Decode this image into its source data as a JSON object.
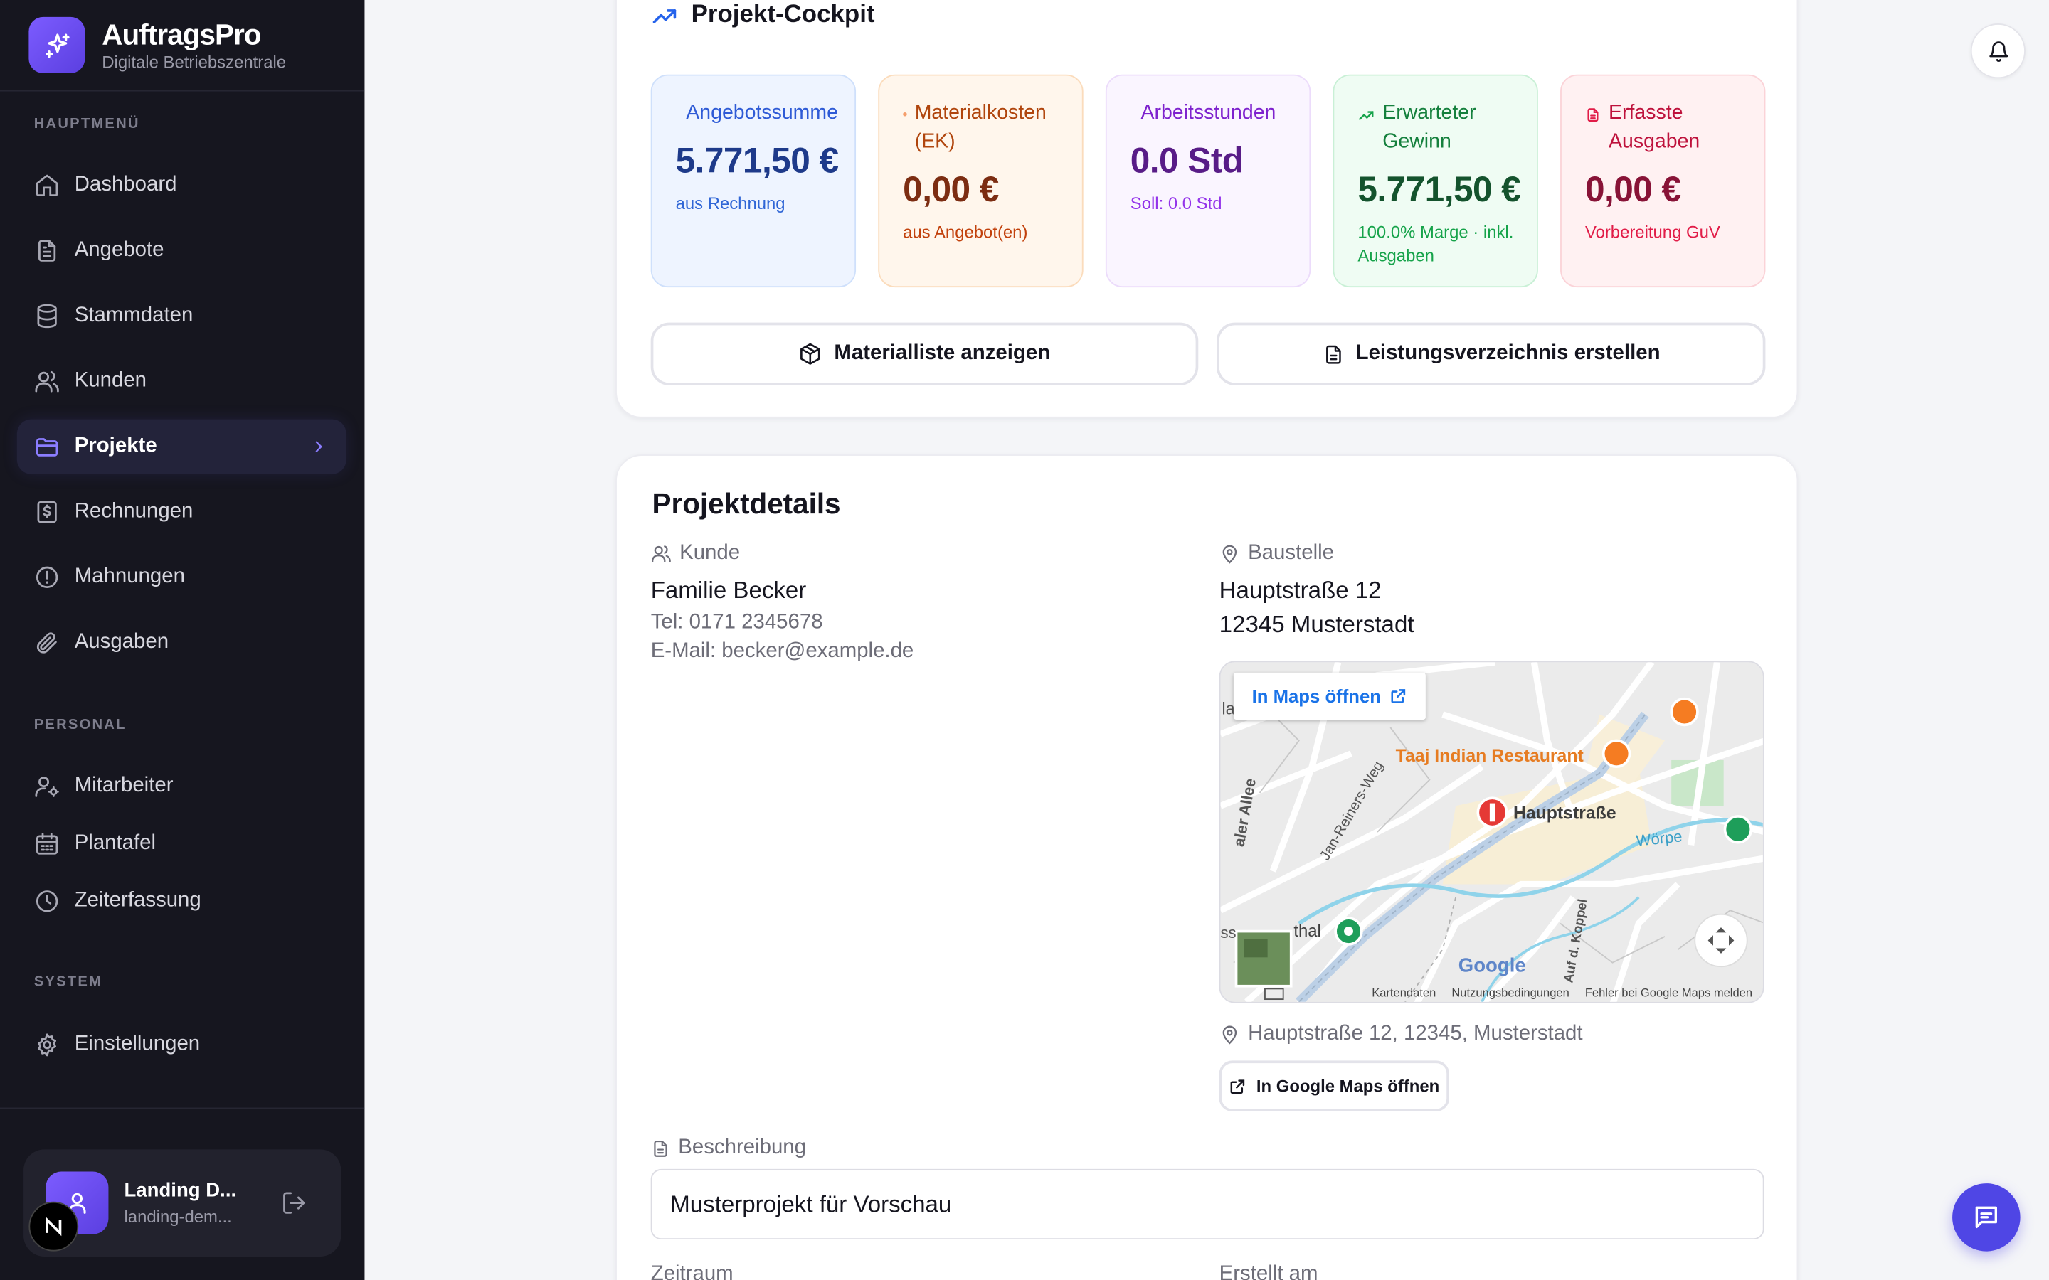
{
  "brand": {
    "name": "AuftragsPro",
    "subtitle": "Digitale Betriebszentrale"
  },
  "sidebar": {
    "sections": {
      "main": "HAUPTMENÜ",
      "personal": "PERSONAL",
      "system": "SYSTEM"
    },
    "items": [
      {
        "label": "Dashboard",
        "icon": "home-icon"
      },
      {
        "label": "Angebote",
        "icon": "document-icon"
      },
      {
        "label": "Stammdaten",
        "icon": "database-icon"
      },
      {
        "label": "Kunden",
        "icon": "users-icon"
      },
      {
        "label": "Projekte",
        "icon": "folder-icon",
        "active": true
      },
      {
        "label": "Rechnungen",
        "icon": "receipt-icon"
      },
      {
        "label": "Mahnungen",
        "icon": "alert-circle-icon"
      },
      {
        "label": "Ausgaben",
        "icon": "paperclip-icon"
      },
      {
        "label": "Mitarbeiter",
        "icon": "user-cog-icon"
      },
      {
        "label": "Plantafel",
        "icon": "calendar-icon"
      },
      {
        "label": "Zeiterfassung",
        "icon": "clock-icon"
      },
      {
        "label": "Einstellungen",
        "icon": "gear-icon"
      }
    ],
    "user": {
      "name": "Landing D...",
      "email": "landing-dem..."
    }
  },
  "cockpit": {
    "title": "Projekt-Cockpit",
    "metrics": [
      {
        "label": "Angebotssumme",
        "value": "5.771,50 €",
        "sub": "aus Rechnung"
      },
      {
        "label": "Materialkosten (EK)",
        "value": "0,00 €",
        "sub": "aus Angebot(en)"
      },
      {
        "label": "Arbeitsstunden",
        "value": "0.0 Std",
        "sub": "Soll: 0.0 Std"
      },
      {
        "label": "Erwarteter Gewinn",
        "value": "5.771,50 €",
        "sub": "100.0% Marge · inkl. Ausgaben"
      },
      {
        "label": "Erfasste Ausgaben",
        "value": "0,00 €",
        "sub": "Vorbereitung GuV"
      }
    ],
    "buttons": {
      "materials": "Materialliste anzeigen",
      "lv": "Leistungsverzeichnis erstellen"
    }
  },
  "details": {
    "title": "Projektdetails",
    "customer": {
      "label": "Kunde",
      "name": "Familie Becker",
      "phone": "Tel: 0171 2345678",
      "email": "E-Mail: becker@example.de"
    },
    "site": {
      "label": "Baustelle",
      "street": "Hauptstraße 12",
      "city": "12345 Musterstadt",
      "full_address": "Hauptstraße 12, 12345, Musterstadt",
      "google_button": "In Google Maps öffnen"
    },
    "map": {
      "open_button": "In Maps öffnen",
      "labels": {
        "restaurant": "Taaj Indian Restaurant",
        "street": "Hauptstraße",
        "allee": "aler Allee",
        "weg": "Jan-Reiners-Weg",
        "river": "Wörpe",
        "thal": "thal",
        "la": "la",
        "koppel": "Auf d. Koppel",
        "ss": "ss"
      },
      "attribution": {
        "google": "Google",
        "data": "Kartendaten",
        "terms": "Nutzungsbedingungen",
        "report": "Fehler bei Google Maps melden"
      }
    },
    "description": {
      "label": "Beschreibung",
      "value": "Musterprojekt für Vorschau"
    },
    "period_label": "Zeitraum",
    "created_label": "Erstellt am"
  }
}
